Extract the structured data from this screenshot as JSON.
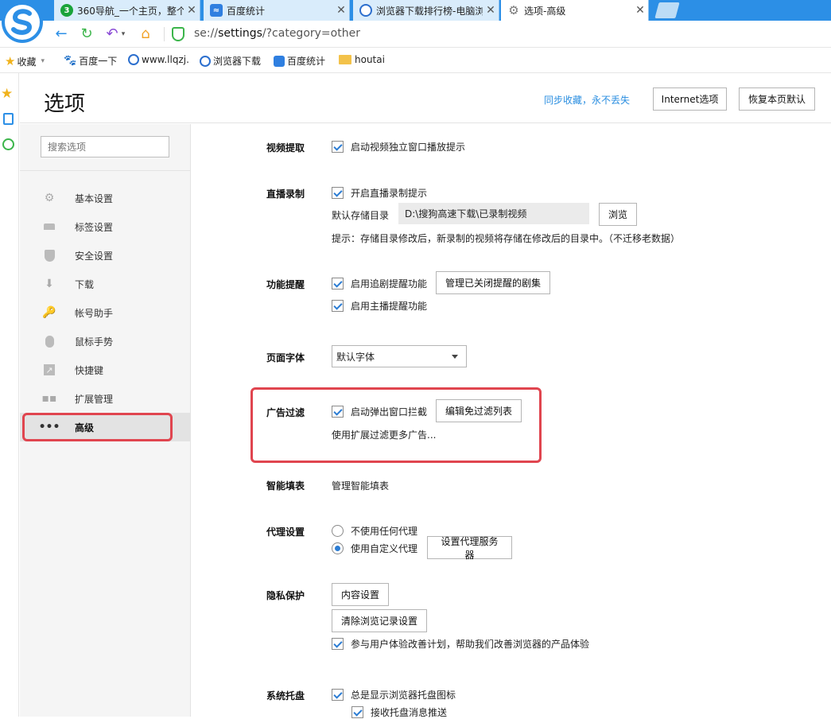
{
  "browser": {
    "tabs": [
      {
        "title": "360导航_一个主页，整个",
        "icon": "360-icon",
        "color": "#1aa33a"
      },
      {
        "title": "百度统计",
        "icon": "baidu-tongji-icon",
        "color": "#2f7fe0"
      },
      {
        "title": "浏览器下载排行榜-电脑浏",
        "icon": "llq-icon",
        "color": "#2c6fce"
      },
      {
        "title": "选项-高级",
        "icon": "gear-icon",
        "color": "#777777"
      }
    ],
    "close_glyph": "✕",
    "address": {
      "scheme": "se://",
      "host": "settings",
      "path": "/?category=other"
    },
    "bookmarks": [
      {
        "label": "收藏",
        "icon": "star-icon"
      },
      {
        "label": "百度一下",
        "icon": "baidu-paw-icon"
      },
      {
        "label": "www.llqzj.",
        "icon": "llq-icon"
      },
      {
        "label": "浏览器下载",
        "icon": "llq-icon"
      },
      {
        "label": "百度统计",
        "icon": "baidu-tongji-icon"
      },
      {
        "label": "houtai",
        "icon": "folder-icon"
      }
    ]
  },
  "header": {
    "title": "选项",
    "sync_link": "同步收藏，永不丢失",
    "internet_options": "Internet选项",
    "restore_default": "恢复本页默认"
  },
  "sidebar": {
    "search_placeholder": "搜索选项",
    "items": [
      {
        "label": "基本设置",
        "icon": "gear-icon"
      },
      {
        "label": "标签设置",
        "icon": "tab-icon"
      },
      {
        "label": "安全设置",
        "icon": "shield-icon"
      },
      {
        "label": "下载",
        "icon": "download-icon"
      },
      {
        "label": "帐号助手",
        "icon": "key-icon"
      },
      {
        "label": "鼠标手势",
        "icon": "mouse-icon"
      },
      {
        "label": "快捷键",
        "icon": "arrow-icon"
      },
      {
        "label": "扩展管理",
        "icon": "grid-icon"
      },
      {
        "label": "高级",
        "icon": "more-icon",
        "active": true
      }
    ]
  },
  "sections": {
    "video": {
      "label": "视频提取",
      "opt": "启动视频独立窗口播放提示"
    },
    "live": {
      "label": "直播录制",
      "opt": "开启直播录制提示",
      "dir_label": "默认存储目录",
      "dir_value": "D:\\搜狗高速下载\\已录制视频",
      "browse": "浏览",
      "hint": "提示：存储目录修改后，新录制的视频将存储在修改后的目录中。（不迁移老数据）"
    },
    "remind": {
      "label": "功能提醒",
      "opt1": "启用追剧提醒功能",
      "btn": "管理已关闭提醒的剧集",
      "opt2": "启用主播提醒功能"
    },
    "font": {
      "label": "页面字体",
      "value": "默认字体"
    },
    "adblock": {
      "label": "广告过滤",
      "opt": "启动弹出窗口拦截",
      "btn": "编辑免过滤列表",
      "link": "使用扩展过滤更多广告..."
    },
    "autofill": {
      "label": "智能填表",
      "link": "管理智能填表"
    },
    "proxy": {
      "label": "代理设置",
      "opt1": "不使用任何代理",
      "opt2": "使用自定义代理",
      "btn": "设置代理服务器"
    },
    "privacy": {
      "label": "隐私保护",
      "btn1": "内容设置",
      "btn2": "清除浏览记录设置",
      "opt": "参与用户体验改善计划，帮助我们改善浏览器的产品体验"
    },
    "tray": {
      "label": "系统托盘",
      "opt1": "总是显示浏览器托盘图标",
      "opt2": "接收托盘消息推送"
    }
  }
}
